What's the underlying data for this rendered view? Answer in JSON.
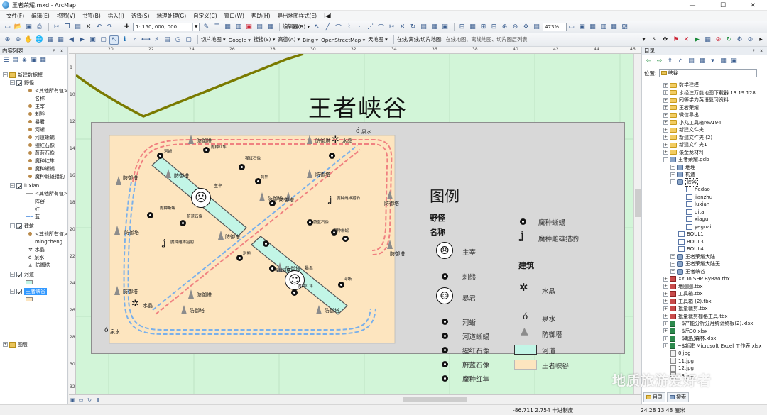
{
  "window": {
    "title": "王者荣耀.mxd - ArcMap",
    "min": "—",
    "max": "☐",
    "close": "✕"
  },
  "menu": [
    "文件(F)",
    "编辑(E)",
    "视图(V)",
    "书签(B)",
    "插入(I)",
    "选择(S)",
    "地理处理(G)",
    "自定义(C)",
    "窗口(W)",
    "帮助(H)",
    "导出地图样式(E)",
    "I◀I"
  ],
  "toolbar": {
    "scale": "1: 150, 000, 000",
    "editor": "编辑器(R) ▾",
    "zoom": "473%",
    "tiles": "切片地图 ▾",
    "google": "Google ▾",
    "soso": "搜搜(S) ▾",
    "gaode": "高德(A) ▾",
    "bing": "Bing ▾",
    "osm": "OpenStreetMap ▾",
    "tianditu": "天地图 ▾",
    "online": "在线/离线/切片地图:",
    "online_hint": "在线地图、离线地图、切片图层列表"
  },
  "toc": {
    "title": "内容列表",
    "pin": "ᵖ ×",
    "rows": [
      "新建数据框",
      "野怪",
      "<其他所有值>",
      "名称",
      "主宰",
      "刺熊",
      "暴君",
      "河蜥",
      "河道蜥蜴",
      "猩红石像",
      "蔚蓝石像",
      "魔种红隼",
      "魔种蜥蜴",
      "魔种雌雄猎豹",
      "luxian",
      "<其他所有值>",
      "阵容",
      "红",
      "蓝",
      "建筑",
      "<其他所有值>",
      "mingcheng",
      "水晶",
      "泉水",
      "防御塔",
      "河道",
      "王者峡谷",
      "图层"
    ]
  },
  "map": {
    "title": "王者峡谷",
    "ruler_h": [
      "20",
      "22",
      "24",
      "26",
      "28",
      "30",
      "32",
      "34",
      "36",
      "38",
      "40",
      "42",
      "44",
      "46"
    ],
    "ruler_v": [
      "8",
      "10",
      "12",
      "14",
      "16",
      "18",
      "20",
      "22",
      "24",
      "26",
      "28",
      "30",
      "32"
    ],
    "labels": {
      "tower": "防御塔",
      "crystal": "水晶",
      "spring": "泉水",
      "lord": "主宰",
      "tyrant": "暴君",
      "bear": "刺熊",
      "lizard": "河道蜥蜴",
      "river_lizard": "河蜥",
      "red_golem": "猩红石像",
      "blue_golem": "蔚蓝石像",
      "falcon": "魔种红隼",
      "mlizard": "魔种蜥蜴",
      "leopard": "魔种雌雄猎豹",
      "leopard_short": "魔种雌雄猎豹"
    }
  },
  "legend": {
    "title": "图例",
    "monsters": "野怪",
    "name": "名称",
    "lord": "主宰",
    "bear": "刺熊",
    "tyrant": "暴君",
    "river_lizard": "河蜥",
    "lizard": "河道蜥蜴",
    "red_golem": "猩红石像",
    "blue_golem": "蔚蓝石像",
    "falcon": "魔种红隼",
    "mlizard": "魔种蜥蜴",
    "leopard": "魔种雌雄猎豹",
    "buildings": "建筑",
    "crystal": "水晶",
    "spring": "泉水",
    "tower": "防御塔",
    "river": "河道",
    "canyon": "王者峡谷"
  },
  "catalog": {
    "title": "目录",
    "location_label": "位置:",
    "location_value": "峡谷",
    "rows": [
      "数学建模",
      "水经注万能地图下载器 13.19.128",
      "同等学力英语复习资料",
      "王者荣耀",
      "微信导出",
      "小丸工具箱rev194",
      "新建文件夹",
      "新建文件夹 (2)",
      "新建文件夹1",
      "张金龙材料",
      "王者荣耀.gdb",
      "地理",
      "构造",
      "峡谷",
      "hedao",
      "jianzhu",
      "luxian",
      "qita",
      "xiagu",
      "yeguai",
      "BOUL1",
      "BOUL3",
      "BOUL4",
      "王者荣耀大陆",
      "王者荣耀大陆无",
      "王者峡谷",
      "XY To SHP ByBao.tbx",
      "地图图.tbx",
      "工具箱.tbx",
      "工具箱 (2).tbx",
      "批量裁剪.tbx",
      "批量裁剪栅格工具.tbx",
      "~$产能分析分月统计终板(2).xlsx",
      "~$岳30.xlsx",
      "~$超配森林.xlsx",
      "~$新建 Microsoft Excel 工作表.xlsx",
      "0.jpg",
      "11.jpg",
      "12.jpg",
      "13.jpg"
    ],
    "tab_catalog": "目录",
    "tab_search": "搜索"
  },
  "status": {
    "coords": "-86.711  2.754 十进制度",
    "page": "24.28  13.48 厘米"
  },
  "watermark": "地质旅游爱好者",
  "colors": {
    "canyon_fill": "#fde5bf",
    "river_fill": "#c2f5e6",
    "background": "#d2f5d8",
    "red_route": "#f08080",
    "blue_route": "#7ab0ea",
    "road": "#7a7a00"
  }
}
